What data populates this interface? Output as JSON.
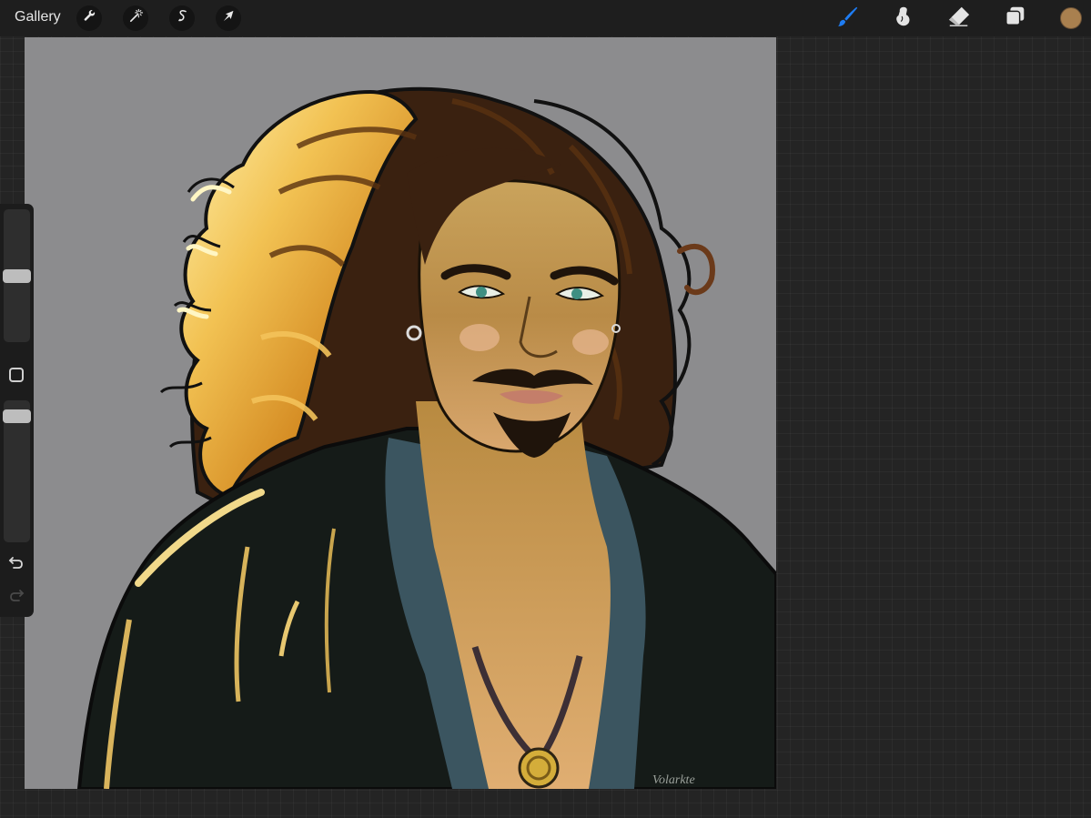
{
  "toolbar": {
    "gallery_label": "Gallery",
    "left_tools": [
      "wrench-icon",
      "magic-wand-icon",
      "selection-icon",
      "transform-arrow-icon"
    ],
    "right_tools": [
      "brush-icon",
      "smudge-icon",
      "eraser-icon",
      "layers-icon"
    ],
    "active_tool": "brush-icon",
    "active_tool_color": "#1e7cf2",
    "current_color": "#a9804f"
  },
  "artwork": {
    "signature_text": "Volarkte",
    "background_color": "#8c8c8e"
  },
  "sidebar": {
    "brush_size_level": 0.5,
    "opacity_level": 0.93,
    "undo_icon": "undo-icon",
    "redo_icon": "redo-icon",
    "redo_enabled": false
  }
}
